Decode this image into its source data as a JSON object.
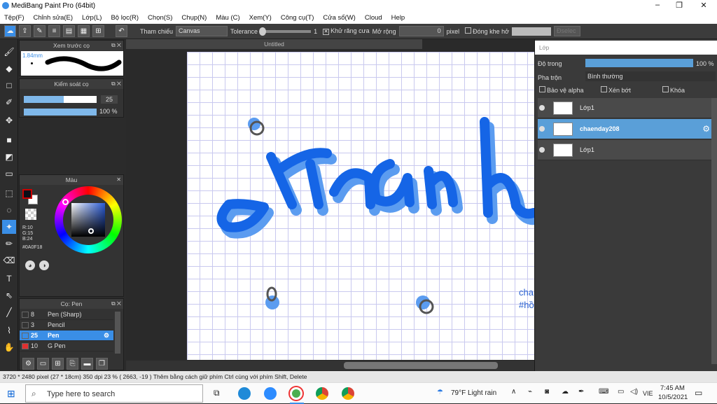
{
  "app": {
    "title": "MediBang Paint Pro (64bit)",
    "minimize": "–",
    "maximize": "❐",
    "close": "✕"
  },
  "menu": [
    "Tệp(F)",
    "Chỉnh sửa(E)",
    "Lớp(L)",
    "Bộ lọc(R)",
    "Chọn(S)",
    "Chụp(N)",
    "Màu (C)",
    "Xem(Y)",
    "Công cụ(T)",
    "Cửa sổ(W)",
    "Cloud",
    "Help"
  ],
  "toolbar": {
    "ref_label": "Tham chiếu",
    "ref_value": "Canvas",
    "tolerance_label": "Tolerance",
    "tolerance_value": "1",
    "antialias_label": "Khử răng cưa",
    "expand_label": "Mở rộng",
    "expand_value": "0",
    "expand_unit": "pixel",
    "close_gap_label": "Đóng khe hở",
    "select_label": "Đselec"
  },
  "document": {
    "tab": "Untitled"
  },
  "preview_panel": {
    "title": "Xem trước cọ",
    "size": "1.84mm"
  },
  "control_panel": {
    "title": "Kiểm soát cọ",
    "size_value": "25",
    "opacity_value": "100 %",
    "size_fill": 0.55,
    "opacity_fill": 1.0
  },
  "color_panel": {
    "title": "Màu",
    "r": "R:10",
    "g": "G:15",
    "b": "B:24",
    "hex": "#0A0F18",
    "fg_color": "#0A0F18"
  },
  "brush_panel": {
    "title": "Cọ: Pen",
    "items": [
      {
        "size": "8",
        "name": "Pen (Sharp)",
        "color": "#333333"
      },
      {
        "size": "3",
        "name": "Pencil",
        "color": "#333333"
      },
      {
        "size": "25",
        "name": "Pen",
        "color": "#3a8ee6"
      },
      {
        "size": "10",
        "name": "G Pen",
        "color": "#e03030"
      }
    ]
  },
  "layers_panel": {
    "title": "Lớp",
    "opacity_label": "Độ trong",
    "opacity_value": "100 %",
    "blend_label": "Pha trộn",
    "blend_value": "Bình thường",
    "protect_alpha": "Bảo vệ alpha",
    "clipping": "Xén bớt",
    "lock": "Khóa",
    "layers": [
      {
        "name": "Lớp1",
        "selected": false
      },
      {
        "name": "chaenday208",
        "selected": true
      },
      {
        "name": "Lớp1",
        "selected": false
      }
    ]
  },
  "canvas_text": {
    "line1": "cha",
    "line2": "#hồ"
  },
  "status": "3720 * 2480 pixel   (27 * 18cm)   350 dpi   23 %   ( 2663, -19 )   Thêm bằng cách giữ phím Ctrl cùng với phím Shift, Delete",
  "taskbar": {
    "search_placeholder": "Type here to search",
    "weather": "79°F  Light rain",
    "lang": "VIE",
    "time": "7:45 AM",
    "date": "10/5/2021"
  }
}
